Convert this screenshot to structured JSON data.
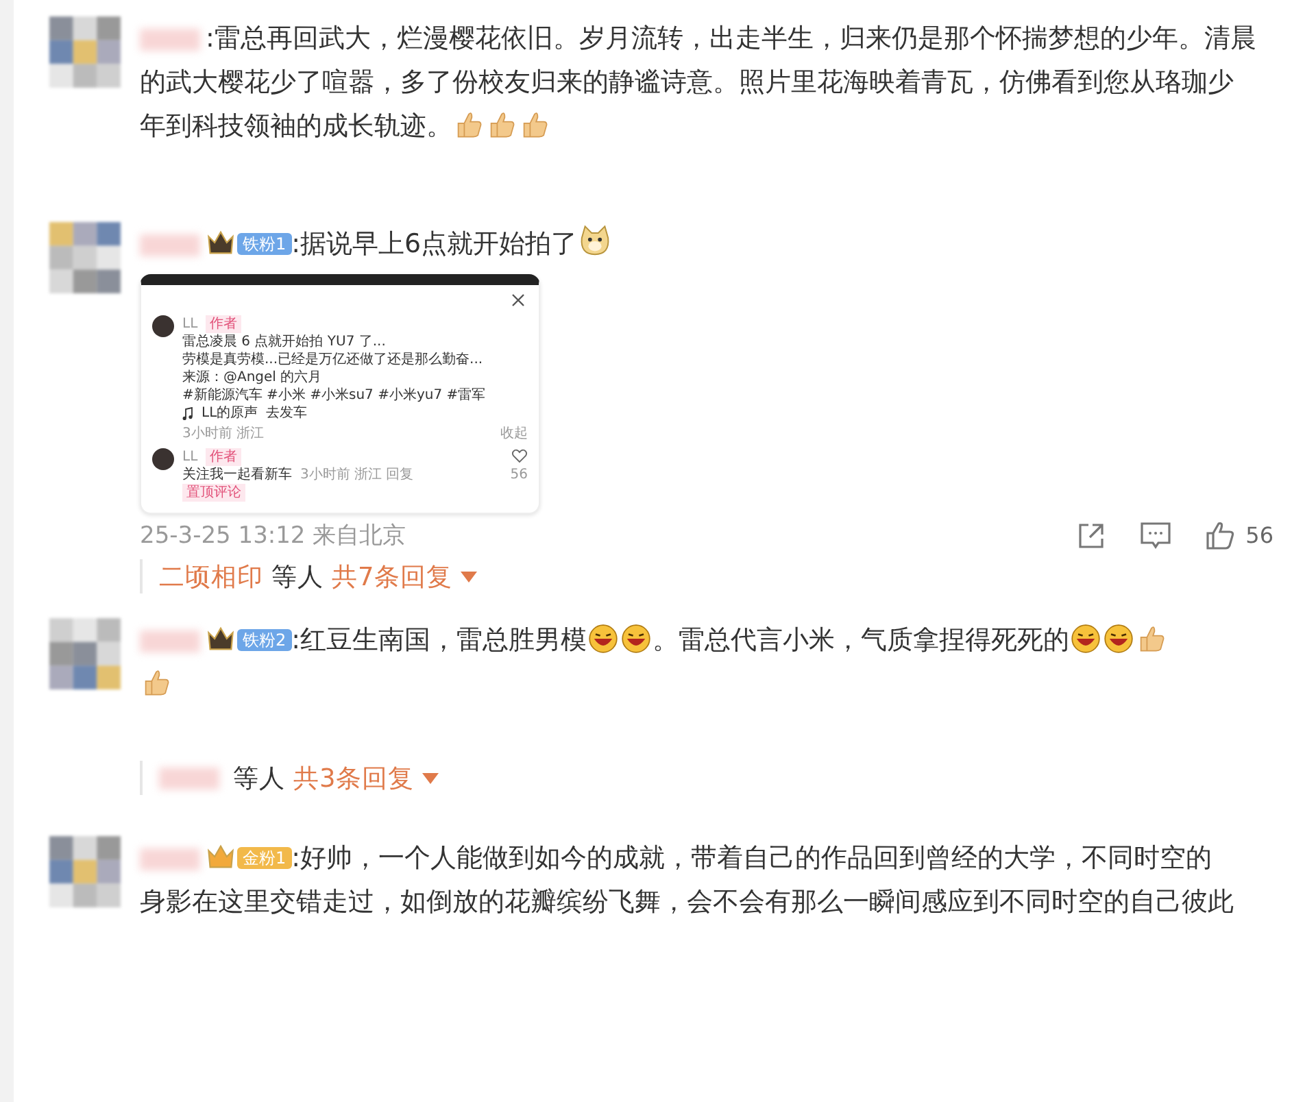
{
  "comments": [
    {
      "lines": [
        [
          {
            "kind": "text",
            "text": ":雷总再回武大，烂漫樱花依旧。岁月流转，出走半生，归来仍是那个怀揣梦想的少年。清晨"
          }
        ],
        [
          {
            "kind": "text",
            "text": "的武大樱花少了喧嚣，多了份校友归来的静谧诗意。照片里花海映着青瓦，仿佛看到您从珞珈少"
          }
        ],
        [
          {
            "kind": "text",
            "text": "年到科技领袖的成长轨迹。"
          },
          {
            "kind": "thumb"
          },
          {
            "kind": "thumb"
          },
          {
            "kind": "thumb"
          }
        ]
      ]
    },
    {
      "badge": {
        "kind": "iron",
        "label": "铁粉1"
      },
      "lines": [
        [
          {
            "kind": "text",
            "text": ":据说早上6点就开始拍了"
          },
          {
            "kind": "doge"
          }
        ]
      ],
      "attachment": {
        "author": "LL",
        "author_tag": "作者",
        "lines": [
          "雷总凌晨 6 点就开始拍 YU7 了...",
          "劳模是真劳模...已经是万亿还做了还是那么勤奋...",
          "来源：@Angel 的六月",
          "#新能源汽车 #小米 #小米su7 #小米yu7 #雷军"
        ],
        "music": "LL的原声",
        "music_extra": "去发车",
        "time": "3小时前 浙江",
        "collapse": "收起",
        "reply_author": "LL",
        "reply_tag": "作者",
        "reply_text": "关注我一起看新车",
        "reply_meta": "3小时前 浙江 回复",
        "reply_likes": "56",
        "pinned": "置顶评论"
      },
      "meta": {
        "time": "25-3-25 13:12 来自北京",
        "likes": "56"
      },
      "replies": {
        "name": "二顷相印",
        "others": "等人",
        "count": "共7条回复"
      }
    },
    {
      "badge": {
        "kind": "iron",
        "label": "铁粉2"
      },
      "lines": [
        [
          {
            "kind": "text",
            "text": ":红豆生南国，雷总胜男模"
          },
          {
            "kind": "laugh"
          },
          {
            "kind": "laugh"
          },
          {
            "kind": "text",
            "text": "。雷总代言小米，气质拿捏得死死的"
          },
          {
            "kind": "laugh"
          },
          {
            "kind": "laugh"
          },
          {
            "kind": "thumb"
          }
        ],
        [
          {
            "kind": "thumb"
          }
        ]
      ],
      "replies": {
        "others": "等人",
        "count": "共3条回复"
      }
    },
    {
      "badge": {
        "kind": "gold",
        "label": "金粉1"
      },
      "lines": [
        [
          {
            "kind": "text",
            "text": ":好帅，一个人能做到如今的成就，带着自己的作品回到曾经的大学，不同时空的"
          }
        ],
        [
          {
            "kind": "text",
            "text": "身影在这里交错走过，如倒放的花瓣缤纷飞舞，会不会有那么一瞬间感应到不同时空的自己彼此"
          }
        ]
      ]
    }
  ]
}
